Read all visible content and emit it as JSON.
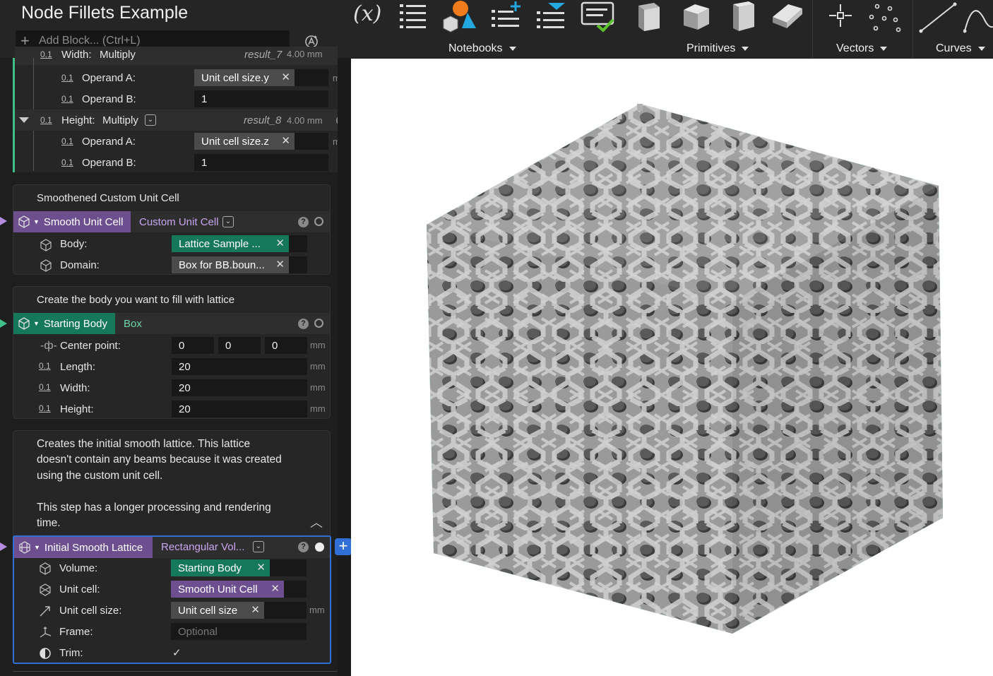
{
  "document": {
    "title": "Node Fillets Example"
  },
  "add_block": {
    "placeholder": "Add Block... (Ctrl+L)"
  },
  "toolbar": {
    "notebooks_label": "Notebooks",
    "primitives_label": "Primitives",
    "vectors_label": "Vectors",
    "curves_label": "Curves",
    "icons": [
      "variable-icon",
      "list-icon",
      "shapes-icon",
      "add-list-icon",
      "filter-list-icon",
      "checklist-icon",
      "cuboid-icon",
      "cube-icon",
      "tall-box-icon",
      "slab-icon",
      "point-icon",
      "point-cloud-icon",
      "line-icon",
      "curve-icon"
    ]
  },
  "partial_block": {
    "width_row": {
      "label": "Width:",
      "op": "Multiply",
      "result": "result_7",
      "value": "4.00 mm"
    },
    "width_a": {
      "label": "Operand A:",
      "value": "Unit cell size.y",
      "unit": "mm"
    },
    "width_b": {
      "label": "Operand B:",
      "value": "1"
    },
    "height_row": {
      "label": "Height:",
      "op": "Multiply",
      "result": "result_8",
      "value": "4.00 mm"
    },
    "height_a": {
      "label": "Operand A:",
      "value": "Unit cell size.z",
      "unit": "mm"
    },
    "height_b": {
      "label": "Operand B:",
      "value": "1"
    }
  },
  "smooth_block": {
    "comment": "Smoothened Custom Unit Cell",
    "name": "Smooth Unit Cell",
    "type": "Custom Unit Cell",
    "body_label": "Body:",
    "body_value": "Lattice Sample ...",
    "domain_label": "Domain:",
    "domain_value": "Box for BB.boun..."
  },
  "starting_block": {
    "comment": "Create the body you want to fill with lattice",
    "name": "Starting Body",
    "type": "Box",
    "center_label": "Center point:",
    "center_x": "0",
    "center_y": "0",
    "center_z": "0",
    "length_label": "Length:",
    "length_value": "20",
    "width_label": "Width:",
    "width_value": "20",
    "height_label": "Height:",
    "height_value": "20",
    "unit": "mm"
  },
  "lattice_block": {
    "comment_1": "Creates the initial smooth lattice. This lattice",
    "comment_2": "doesn't contain any beams because it was created",
    "comment_3": "using the custom unit cell.",
    "comment_4": "This step has a longer processing and rendering",
    "comment_5": "time.",
    "name": "Initial Smooth Lattice",
    "type": "Rectangular Vol...",
    "volume_label": "Volume:",
    "volume_value": "Starting Body",
    "unitcell_label": "Unit cell:",
    "unitcell_value": "Smooth Unit Cell",
    "cellsize_label": "Unit cell size:",
    "cellsize_value": "Unit cell size",
    "cellsize_unit": "mm",
    "frame_label": "Frame:",
    "frame_placeholder": "Optional",
    "trim_label": "Trim:",
    "trim_value": "✓"
  },
  "colors": {
    "accent_blue": "#2f6fd6",
    "green": "#16785a",
    "purple": "#6d4f90",
    "lattice_outline": "#3fd3e0"
  }
}
